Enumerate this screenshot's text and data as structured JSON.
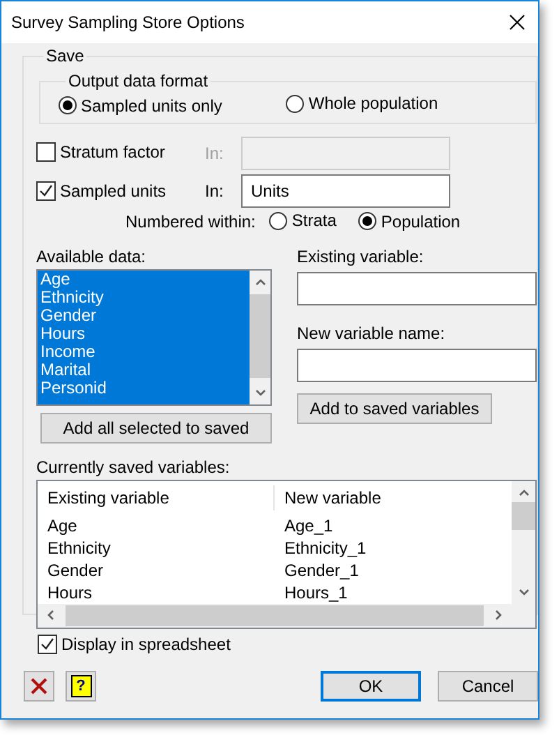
{
  "window": {
    "title": "Survey Sampling Store Options"
  },
  "save_group": {
    "label": "Save"
  },
  "output_format": {
    "label": "Output data format",
    "options": [
      {
        "label": "Sampled units only",
        "selected": true
      },
      {
        "label": "Whole population",
        "selected": false
      }
    ]
  },
  "stratum_factor": {
    "label": "Stratum factor",
    "checked": false,
    "in_label": "In:",
    "disabled": true
  },
  "sampled_units": {
    "label": "Sampled units",
    "checked": true,
    "in_label": "In:",
    "value": "Units",
    "disabled": false
  },
  "numbered_within": {
    "label": "Numbered within:",
    "options": [
      {
        "label": "Strata",
        "selected": false
      },
      {
        "label": "Population",
        "selected": true
      }
    ]
  },
  "available_data": {
    "label": "Available data:",
    "items": [
      {
        "label": "Age",
        "selected": true
      },
      {
        "label": "Ethnicity",
        "selected": true
      },
      {
        "label": "Gender",
        "selected": true
      },
      {
        "label": "Hours",
        "selected": true
      },
      {
        "label": "Income",
        "selected": true
      },
      {
        "label": "Marital",
        "selected": true
      },
      {
        "label": "Personid",
        "selected": true
      }
    ]
  },
  "add_all_button": {
    "label": "Add all selected to saved"
  },
  "existing_variable": {
    "label": "Existing variable:"
  },
  "new_variable_name": {
    "label": "New variable name:"
  },
  "add_button": {
    "label": "Add to saved variables"
  },
  "saved_variables": {
    "label": "Currently saved variables:",
    "columns": [
      "Existing variable",
      "New variable"
    ],
    "rows": [
      [
        "Age",
        "Age_1"
      ],
      [
        "Ethnicity",
        "Ethnicity_1"
      ],
      [
        "Gender",
        "Gender_1"
      ],
      [
        "Hours",
        "Hours_1"
      ]
    ]
  },
  "display_in_spreadsheet": {
    "label": "Display in spreadsheet",
    "checked": true
  },
  "buttons": [
    {
      "kind": "clear"
    },
    {
      "kind": "help",
      "label": "?"
    },
    {
      "kind": "text",
      "label": "OK",
      "default": true
    },
    {
      "kind": "text",
      "label": "Cancel",
      "default": false
    }
  ]
}
